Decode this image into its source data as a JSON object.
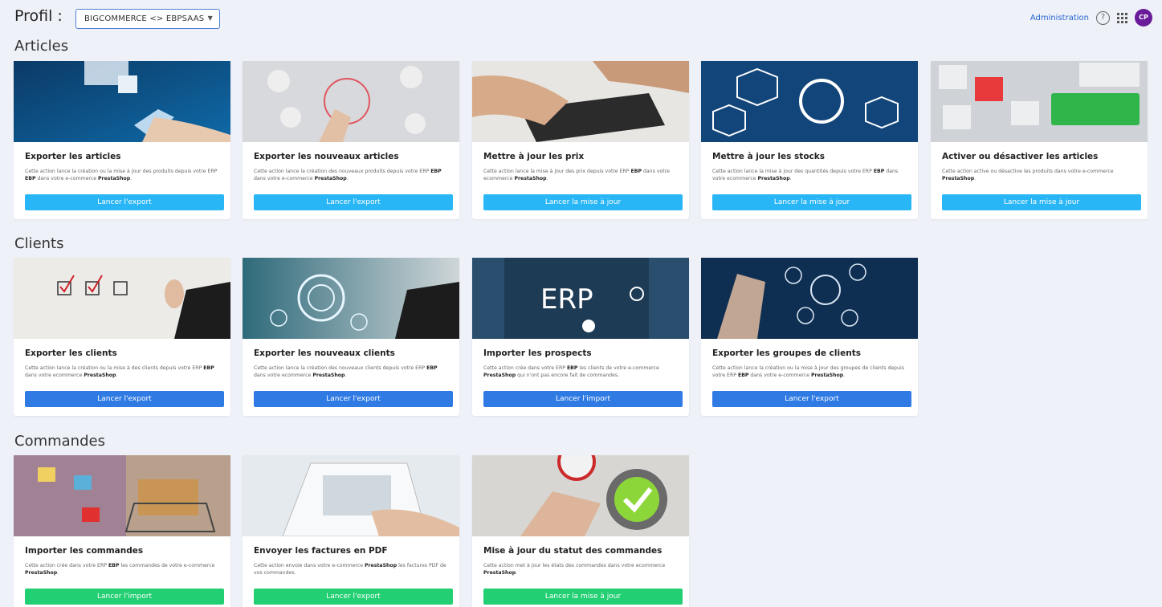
{
  "header": {
    "profil_label": "Profil :",
    "profil_value": "BIGCOMMERCE <> EBPSAAS",
    "admin_link": "Administration",
    "help_icon": "?",
    "avatar_initials": "CP"
  },
  "colors": {
    "cyan_button": "#29b6f6",
    "blue_button": "#2f7be3",
    "green_button": "#22cf72",
    "avatar": "#6a1b9a",
    "link": "#2a66d0"
  },
  "sections": {
    "articles": {
      "title": "Articles",
      "cards": [
        {
          "title": "Exporter les articles",
          "desc_pre": "Cette action lance la création ou la mise à jour des produits depuis votre ERP ",
          "desc_b1": "EBP",
          "desc_mid": " dans votre e-commerce ",
          "desc_b2": "PrestaShop",
          "desc_post": ".",
          "button": "Lancer l'export"
        },
        {
          "title": "Exporter les nouveaux articles",
          "desc_pre": "Cette action lance la création des nouveaux produits depuis votre ERP ",
          "desc_b1": "EBP",
          "desc_mid": " dans votre e-commerce ",
          "desc_b2": "PrestaShop",
          "desc_post": ".",
          "button": "Lancer l'export"
        },
        {
          "title": "Mettre à jour les prix",
          "desc_pre": "Cette action lance la mise à jour des prix depuis votre ERP ",
          "desc_b1": "EBP",
          "desc_mid": " dans votre ecommerce ",
          "desc_b2": "PrestaShop",
          "desc_post": ".",
          "button": "Lancer la mise à jour"
        },
        {
          "title": "Mettre à jour les stocks",
          "desc_pre": "Cette action lance la mise à jour des quantités depuis votre ERP ",
          "desc_b1": "EBP",
          "desc_mid": " dans votre ecommerce ",
          "desc_b2": "PrestaShop",
          "desc_post": ".",
          "button": "Lancer la mise à jour"
        },
        {
          "title": "Activer ou désactiver les articles",
          "desc_pre": "Cette action active ou désactive les produits dans votre e-commerce ",
          "desc_b1": "",
          "desc_mid": "",
          "desc_b2": "PrestaShop",
          "desc_post": ".",
          "button": "Lancer la mise à jour"
        }
      ]
    },
    "clients": {
      "title": "Clients",
      "cards": [
        {
          "title": "Exporter les clients",
          "desc_pre": "Cette action lance la création ou la mise à des clients depuis votre ERP ",
          "desc_b1": "EBP",
          "desc_mid": " dans votre ecommerce ",
          "desc_b2": "PrestaShop",
          "desc_post": ".",
          "button": "Lancer l'export"
        },
        {
          "title": "Exporter les nouveaux clients",
          "desc_pre": "Cette action lance la création des nouveaux clients depuis votre ERP ",
          "desc_b1": "EBP",
          "desc_mid": " dans votre ecommerce ",
          "desc_b2": "PrestaShop",
          "desc_post": ".",
          "button": "Lancer l'export"
        },
        {
          "title": "Importer les prospects",
          "desc_pre": "Cette action crée dans votre ERP ",
          "desc_b1": "EBP",
          "desc_mid": " les clients de votre e-commerce ",
          "desc_b2": "PrestaShop",
          "desc_post": " qui n'ont pas encore fait de commandes.",
          "button": "Lancer l'import"
        },
        {
          "title": "Exporter les groupes de clients",
          "desc_pre": "Cette action lance la création ou la mise à jour des groupes de clients depuis votre ERP ",
          "desc_b1": "EBP",
          "desc_mid": " dans votre e-commerce ",
          "desc_b2": "PrestaShop",
          "desc_post": ".",
          "button": "Lancer l'export"
        }
      ]
    },
    "commandes": {
      "title": "Commandes",
      "cards": [
        {
          "title": "Importer les commandes",
          "desc_pre": "Cette action crée dans votre ERP ",
          "desc_b1": "EBP",
          "desc_mid": " les commandes de votre e-commerce ",
          "desc_b2": "PrestaShop",
          "desc_post": ".",
          "button": "Lancer l'import"
        },
        {
          "title": "Envoyer les factures en PDF",
          "desc_pre": "Cette action envoie dans votre e-commerce ",
          "desc_b1": "PrestaShop",
          "desc_mid": " les factures PDF de vos commandes.",
          "desc_b2": "",
          "desc_post": "",
          "button": "Lancer l'export"
        },
        {
          "title": "Mise à jour du statut des commandes",
          "desc_pre": "Cette action met à jour les états des commandes dans votre ecommerce ",
          "desc_b1": "",
          "desc_mid": "",
          "desc_b2": "PrestaShop",
          "desc_post": ".",
          "button": "Lancer la mise à jour"
        }
      ]
    }
  }
}
